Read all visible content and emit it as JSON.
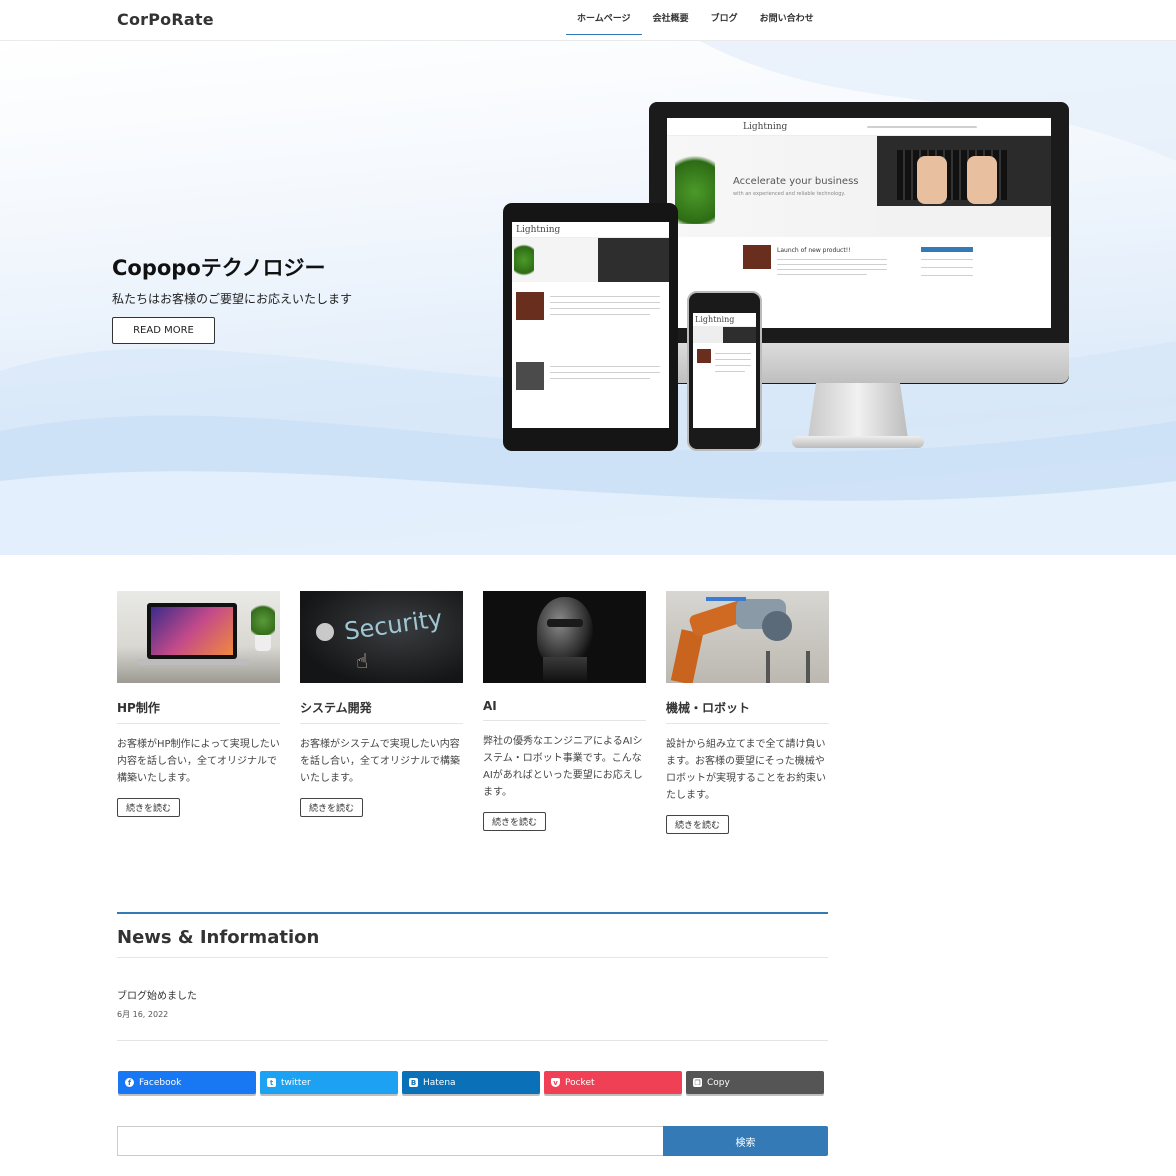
{
  "header": {
    "logo": "CorPoRate",
    "nav": [
      "ホームページ",
      "会社概要",
      "ブログ",
      "お問い合わせ"
    ]
  },
  "hero": {
    "title": "Copopoテクノロジー",
    "subtitle": "私たちはお客様のご要望にお応えいたします",
    "button": "READ MORE",
    "mockup": {
      "brand": "Lightning",
      "tagline": "Accelerate your business",
      "tagline_sub": "with an experienced and reliable technology.",
      "post_title": "Launch of new product!!"
    }
  },
  "cards": [
    {
      "title": "HP制作",
      "text": "お客様がHP制作によって実現したい内容を話し合い，全てオリジナルで構築いたします。",
      "button": "続きを読む"
    },
    {
      "title": "システム開発",
      "text": "お客様がシステムで実現したい内容を話し合い，全てオリジナルで構築いたします。",
      "button": "続きを読む"
    },
    {
      "title": "AI",
      "text": "弊社の優秀なエンジニアによるAIシステム・ロボット事業です。こんなAIがあればといった要望にお応えします。",
      "button": "続きを読む"
    },
    {
      "title": "機械・ロボット",
      "text": "設計から組み立てまで全て請け負います。お客様の要望にそった機械やロボットが実現することをお約束いたします。",
      "button": "続きを読む"
    }
  ],
  "security_image_text": "Security",
  "news": {
    "heading": "News & Information",
    "items": [
      {
        "title": "ブログ始めました",
        "date": "6月 16, 2022"
      }
    ]
  },
  "share": [
    {
      "label": "Facebook",
      "color": "#1877f2",
      "icon": "facebook-icon"
    },
    {
      "label": "twitter",
      "color": "#1da1f2",
      "icon": "twitter-icon"
    },
    {
      "label": "Hatena",
      "color": "#0a71b8",
      "icon": "hatena-icon"
    },
    {
      "label": "Pocket",
      "color": "#ef4056",
      "icon": "pocket-icon"
    },
    {
      "label": "Copy",
      "color": "#555555",
      "icon": "copy-icon"
    }
  ],
  "search": {
    "placeholder": "",
    "button": "検索"
  },
  "colors": {
    "accent": "#337ab7"
  }
}
